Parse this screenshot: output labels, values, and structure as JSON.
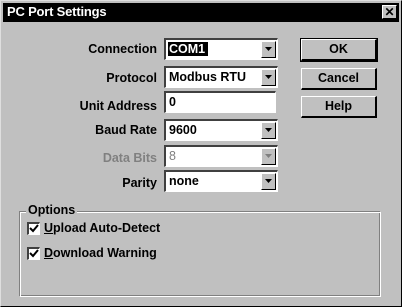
{
  "window": {
    "title": "PC Port Settings",
    "close_glyph": "✕"
  },
  "form": {
    "connection": {
      "label": "Connection",
      "value": "COM1"
    },
    "protocol": {
      "label": "Protocol",
      "value": "Modbus RTU"
    },
    "unit_address": {
      "label": "Unit Address",
      "value": "0"
    },
    "baud_rate": {
      "label": "Baud Rate",
      "value": "9600"
    },
    "data_bits": {
      "label": "Data Bits",
      "value": "8",
      "disabled": true
    },
    "parity": {
      "label": "Parity",
      "value": "none"
    }
  },
  "buttons": {
    "ok": "OK",
    "cancel": "Cancel",
    "help": "Help"
  },
  "options": {
    "title": "Options",
    "upload_auto_detect": {
      "label_first": "U",
      "label_rest": "pload Auto-Detect",
      "checked": true
    },
    "download_warning": {
      "label_first": "D",
      "label_rest": "ownload Warning",
      "checked": true
    }
  },
  "icons": {
    "close": "close-icon",
    "dropdown": "chevron-down-icon",
    "check": "checkmark-icon"
  },
  "colors": {
    "face": "#c0c0c0",
    "titlebar": "#000000",
    "disabled_text": "#808080"
  }
}
